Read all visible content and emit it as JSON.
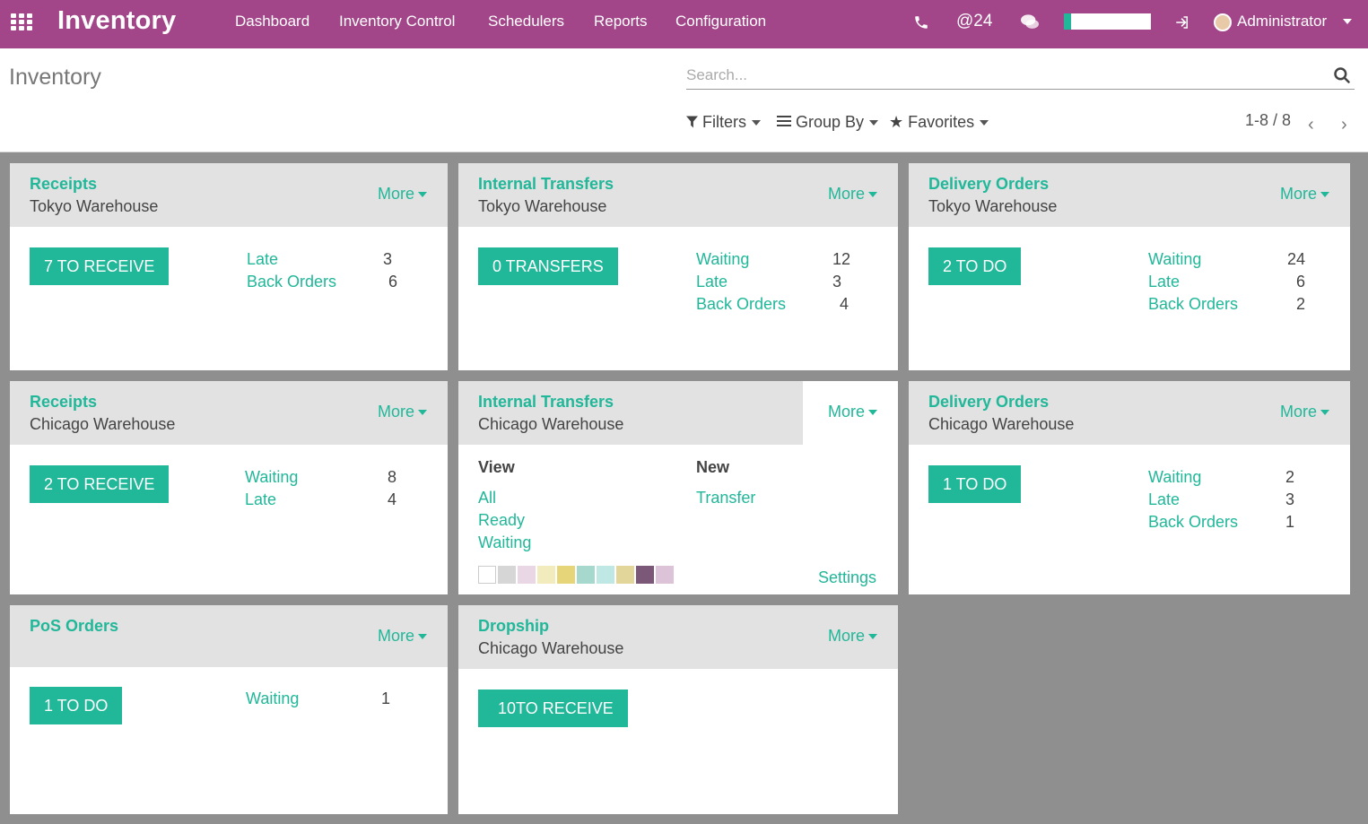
{
  "app": {
    "title": "Inventory"
  },
  "topbar": {
    "menu": [
      "Dashboard",
      "Inventory Control",
      "Schedulers",
      "Reports",
      "Configuration"
    ],
    "mentions": "@24",
    "user": "Administrator"
  },
  "control_panel": {
    "breadcrumb": "Inventory",
    "search_placeholder": "Search...",
    "filters": "Filters",
    "group_by": "Group By",
    "favorites": "Favorites",
    "pager": "1-8 / 8"
  },
  "colors": {
    "primary": "#a24689",
    "accent": "#21b799"
  },
  "cards": [
    {
      "name": "Receipts",
      "warehouse": "Tokyo Warehouse",
      "more": "More",
      "button": "7 TO RECEIVE",
      "stats": [
        {
          "label": "Late",
          "value": "3"
        },
        {
          "label": "Back Orders",
          "value": "6"
        }
      ]
    },
    {
      "name": "Internal Transfers",
      "warehouse": "Tokyo Warehouse",
      "more": "More",
      "button": "0 TRANSFERS",
      "stats": [
        {
          "label": "Waiting",
          "value": "12"
        },
        {
          "label": "Late",
          "value": "3"
        },
        {
          "label": "Back Orders",
          "value": "4"
        }
      ]
    },
    {
      "name": "Delivery Orders",
      "warehouse": "Tokyo Warehouse",
      "more": "More",
      "button": "2 TO DO",
      "stats": [
        {
          "label": "Waiting",
          "value": "24"
        },
        {
          "label": "Late",
          "value": "6"
        },
        {
          "label": "Back Orders",
          "value": "2"
        }
      ]
    },
    {
      "name": "Receipts",
      "warehouse": "Chicago Warehouse",
      "more": "More",
      "button": "2 TO RECEIVE",
      "stats": [
        {
          "label": "Waiting",
          "value": "8"
        },
        {
          "label": "Late",
          "value": "4"
        }
      ]
    },
    {
      "name": "Internal Transfers",
      "warehouse": "Chicago Warehouse",
      "more": "More",
      "dropdown": {
        "view_header": "View",
        "new_header": "New",
        "view_links": [
          "All",
          "Ready",
          "Waiting"
        ],
        "new_links": [
          "Transfer"
        ],
        "settings": "Settings",
        "swatch_colors": [
          "#ffffff",
          "#d6d6d6",
          "#ead7e6",
          "#f2ebbd",
          "#e7d57a",
          "#a6d8cd",
          "#bfe8e4",
          "#e3d69b",
          "#7b5878",
          "#dcc3d8"
        ]
      }
    },
    {
      "name": "Delivery Orders",
      "warehouse": "Chicago Warehouse",
      "more": "More",
      "button": "1 TO DO",
      "stats": [
        {
          "label": "Waiting",
          "value": "2"
        },
        {
          "label": "Late",
          "value": "3"
        },
        {
          "label": "Back Orders",
          "value": "1"
        }
      ]
    },
    {
      "name": "PoS Orders",
      "warehouse": "",
      "more": "More",
      "button": "1 TO DO",
      "stats": [
        {
          "label": "Waiting",
          "value": "1"
        }
      ]
    },
    {
      "name": "Dropship",
      "warehouse": "Chicago Warehouse",
      "more": "More",
      "button": "10TO RECEIVE",
      "stats": []
    }
  ]
}
